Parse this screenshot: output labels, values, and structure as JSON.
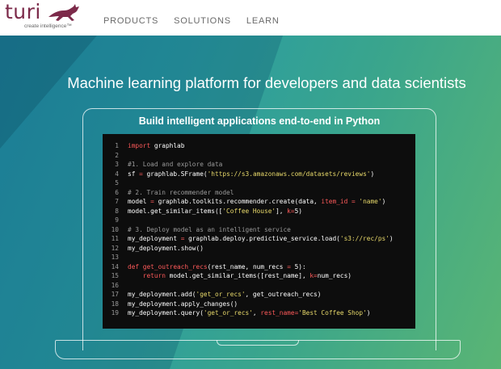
{
  "brand": {
    "logo_text": "turi",
    "tagline": "create intelligence™",
    "colors": {
      "logo": "#7c2a4a",
      "nav_text": "#6a6a6a"
    }
  },
  "nav": {
    "items": [
      {
        "label": "PRODUCTS"
      },
      {
        "label": "SOLUTIONS"
      },
      {
        "label": "LEARN"
      }
    ]
  },
  "hero": {
    "headline": "Machine learning platform for developers and data scientists",
    "screen_title": "Build intelligent applications end-to-end in Python",
    "colors": {
      "gradient_start": "#2390a8",
      "gradient_end": "#5ab574"
    }
  },
  "code": {
    "colors": {
      "background": "#0d0d0d",
      "keyword": "#ff5a5a",
      "comment": "#9a9a9a",
      "string": "#e8d96a",
      "text": "#ffffff"
    },
    "lines": [
      {
        "n": "1",
        "tokens": [
          [
            "kw",
            "import"
          ],
          [
            "tx",
            " graphlab"
          ]
        ]
      },
      {
        "n": "2",
        "tokens": []
      },
      {
        "n": "3",
        "tokens": [
          [
            "cm",
            "#1. Load and explore data"
          ]
        ]
      },
      {
        "n": "4",
        "tokens": [
          [
            "tx",
            "sf "
          ],
          [
            "op",
            "="
          ],
          [
            "tx",
            " graphlab.SFrame("
          ],
          [
            "st",
            "'https://s3.amazonaws.com/datasets/reviews'"
          ],
          [
            "tx",
            ")"
          ]
        ]
      },
      {
        "n": "5",
        "tokens": []
      },
      {
        "n": "6",
        "tokens": [
          [
            "cm",
            "# 2. Train recommender model"
          ]
        ]
      },
      {
        "n": "7",
        "tokens": [
          [
            "tx",
            "model "
          ],
          [
            "op",
            "="
          ],
          [
            "tx",
            " graphlab.toolkits.recommender.create(data, "
          ],
          [
            "nm",
            "item_id"
          ],
          [
            "tx",
            " "
          ],
          [
            "op",
            "="
          ],
          [
            "tx",
            " "
          ],
          [
            "st",
            "'name'"
          ],
          [
            "tx",
            ")"
          ]
        ]
      },
      {
        "n": "8",
        "tokens": [
          [
            "tx",
            "model.get_similar_items(["
          ],
          [
            "st",
            "'Coffee House'"
          ],
          [
            "tx",
            "], "
          ],
          [
            "nm",
            "k"
          ],
          [
            "op",
            "="
          ],
          [
            "tx",
            "5)"
          ]
        ]
      },
      {
        "n": "9",
        "tokens": []
      },
      {
        "n": "10",
        "tokens": [
          [
            "cm",
            "# 3. Deploy model as an intelligent service"
          ]
        ]
      },
      {
        "n": "11",
        "tokens": [
          [
            "tx",
            "my_deployment "
          ],
          [
            "op",
            "="
          ],
          [
            "tx",
            " graphlab.deploy.predictive_service.load("
          ],
          [
            "st",
            "'s3://rec/ps'"
          ],
          [
            "tx",
            ")"
          ]
        ]
      },
      {
        "n": "12",
        "tokens": [
          [
            "tx",
            "my_deployment.show()"
          ]
        ]
      },
      {
        "n": "13",
        "tokens": []
      },
      {
        "n": "14",
        "tokens": [
          [
            "kw",
            "def"
          ],
          [
            "tx",
            " "
          ],
          [
            "nm",
            "get_outreach_recs"
          ],
          [
            "tx",
            "(rest_name, num_recs "
          ],
          [
            "op",
            "="
          ],
          [
            "tx",
            " 5):"
          ]
        ]
      },
      {
        "n": "15",
        "tokens": [
          [
            "tx",
            "    "
          ],
          [
            "kw",
            "return"
          ],
          [
            "tx",
            " model.get_similar_items([rest_name], "
          ],
          [
            "nm",
            "k"
          ],
          [
            "op",
            "="
          ],
          [
            "tx",
            "num_recs)"
          ]
        ]
      },
      {
        "n": "16",
        "tokens": []
      },
      {
        "n": "17",
        "tokens": [
          [
            "tx",
            "my_deployment.add("
          ],
          [
            "st",
            "'get_or_recs'"
          ],
          [
            "tx",
            ", get_outreach_recs)"
          ]
        ]
      },
      {
        "n": "18",
        "tokens": [
          [
            "tx",
            "my_deployment.apply_changes()"
          ]
        ]
      },
      {
        "n": "19",
        "tokens": [
          [
            "tx",
            "my_deployment.query("
          ],
          [
            "st",
            "'get_or_recs'"
          ],
          [
            "tx",
            ", "
          ],
          [
            "nm",
            "rest_name"
          ],
          [
            "op",
            "="
          ],
          [
            "st",
            "'Best Coffee Shop'"
          ],
          [
            "tx",
            ")"
          ]
        ]
      }
    ]
  }
}
